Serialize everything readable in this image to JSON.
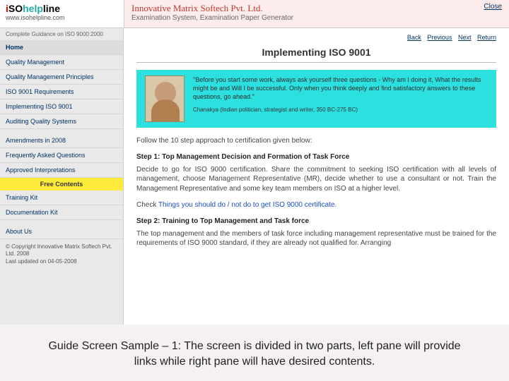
{
  "header": {
    "logo_brand": "iSOhelpline",
    "logo_url": "www.isohelpline.com",
    "company": "Innovative Matrix Softech Pvt. Ltd.",
    "subtitle": "Examination System, Examination Paper Generator",
    "close": "Close"
  },
  "sidebar": {
    "tagline": "Complete Guidance on ISO 9000:2000",
    "links_top": [
      "Home",
      "Quality Management",
      "Quality Management Principles",
      "ISO 9001 Requirements",
      "Implementing ISO 9001",
      "Auditing Quality Systems"
    ],
    "links_mid": [
      "Amendments in 2008",
      "Frequently Asked Questions",
      "Approved Interpretations"
    ],
    "section_header": "Free Contents",
    "links_free": [
      "Training Kit",
      "Documentation Kit"
    ],
    "links_bot": [
      "About Us"
    ],
    "copyright": "© Copyright Innovative Matrix Softech Pvt. Ltd. 2008",
    "updated": "Last updated on 04-05-2008"
  },
  "content": {
    "nav": [
      "Back",
      "Previous",
      "Next",
      "Return"
    ],
    "title": "Implementing ISO 9001",
    "quote": "\"Before you start some work, always ask yourself three questions - Why am I doing it, What the results might be and Will I be successful. Only when you think deeply and find satisfactory answers to these questions, go ahead.\"",
    "quote_attr": "Chanakya (Indian politician, strategist and writer, 350 BC-275 BC)",
    "intro": "Follow the 10 step approach to certification given below:",
    "step1_head": "Step 1: Top Management Decision and Formation of Task Force",
    "step1_body": "Decide to go for ISO 9000 certification. Share the commitment to seeking ISO certification with all levels of management, choose Management Representative (MR), decide whether to use a consultant or not. Train the Management Representative and some key team members on ISO at a higher level.",
    "step1_check_pre": "Check ",
    "step1_check_link": "Things you should do / not do to get ISO 9000 certificate.",
    "step2_head": "Step 2: Training to Top Management and Task force",
    "step2_body": "The top management and the members of task force including management representative must be trained for the requirements of ISO 9000 standard, if they are already not qualified for. Arranging"
  },
  "caption": "Guide Screen Sample – 1: The screen is divided in two parts, left pane will provide links while right pane will have desired contents."
}
